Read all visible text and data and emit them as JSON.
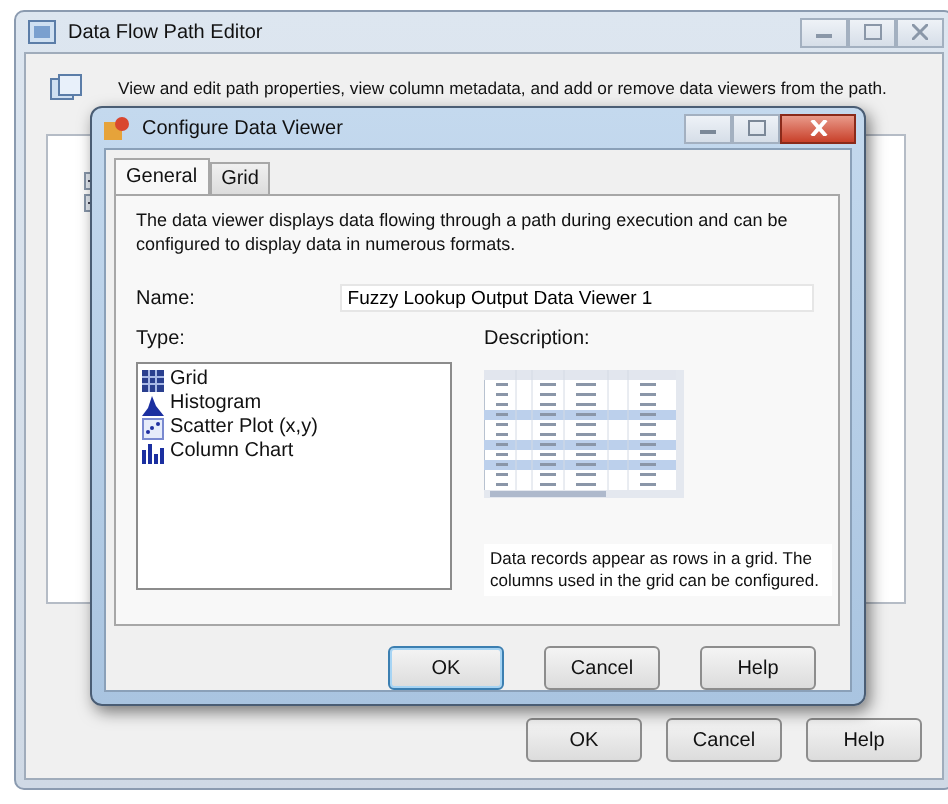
{
  "outer_window": {
    "title": "Data Flow Path Editor",
    "description": "View and edit path properties, view column metadata, and add or remove data viewers from the path.",
    "buttons": [
      "OK",
      "Cancel",
      "Help"
    ]
  },
  "dialog": {
    "title": "Configure Data Viewer",
    "tabs": [
      {
        "label": "General",
        "selected": true
      },
      {
        "label": "Grid",
        "selected": false
      }
    ],
    "intro": "The data viewer displays data flowing through a path during execution and can be configured to display data in numerous formats.",
    "name_label": "Name:",
    "name_value": "Fuzzy Lookup Output Data Viewer 1",
    "type_label": "Type:",
    "types": [
      {
        "label": "Grid",
        "kind": "grid"
      },
      {
        "label": "Histogram",
        "kind": "histogram"
      },
      {
        "label": "Scatter Plot (x,y)",
        "kind": "scatter"
      },
      {
        "label": "Column Chart",
        "kind": "column"
      }
    ],
    "description_label": "Description:",
    "description": "Data records appear as rows in a grid. The columns used in the grid can be configured.",
    "buttons": [
      {
        "label": "OK",
        "default": true
      },
      {
        "label": "Cancel",
        "default": false
      },
      {
        "label": "Help",
        "default": false
      }
    ]
  }
}
